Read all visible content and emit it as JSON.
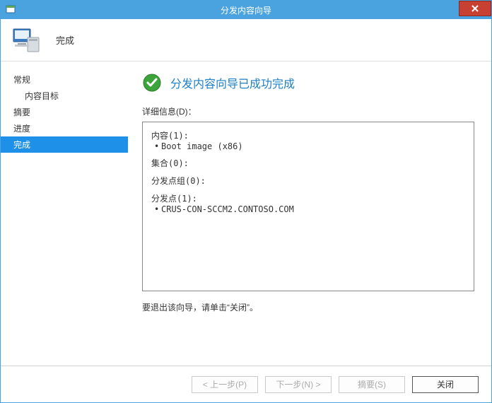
{
  "titlebar": {
    "title": "分发内容向导"
  },
  "header": {
    "label": "完成"
  },
  "sidebar": {
    "items": [
      {
        "label": "常规"
      },
      {
        "label": "内容目标"
      },
      {
        "label": "摘要"
      },
      {
        "label": "进度"
      },
      {
        "label": "完成"
      }
    ]
  },
  "content": {
    "success_title": "分发内容向导已成功完成",
    "details_label": "详细信息(D)：",
    "details": {
      "content_label": "内容(1):",
      "content_item": "Boot image (x86)",
      "collection_label": "集合(0):",
      "dpgroup_label": "分发点组(0):",
      "dp_label": "分发点(1):",
      "dp_item": "CRUS-CON-SCCM2.CONTOSO.COM"
    },
    "exit_hint": "要退出该向导，请单击“关闭”。"
  },
  "footer": {
    "prev": "< 上一步(P)",
    "next": "下一步(N) >",
    "summary": "摘要(S)",
    "close": "关闭"
  }
}
